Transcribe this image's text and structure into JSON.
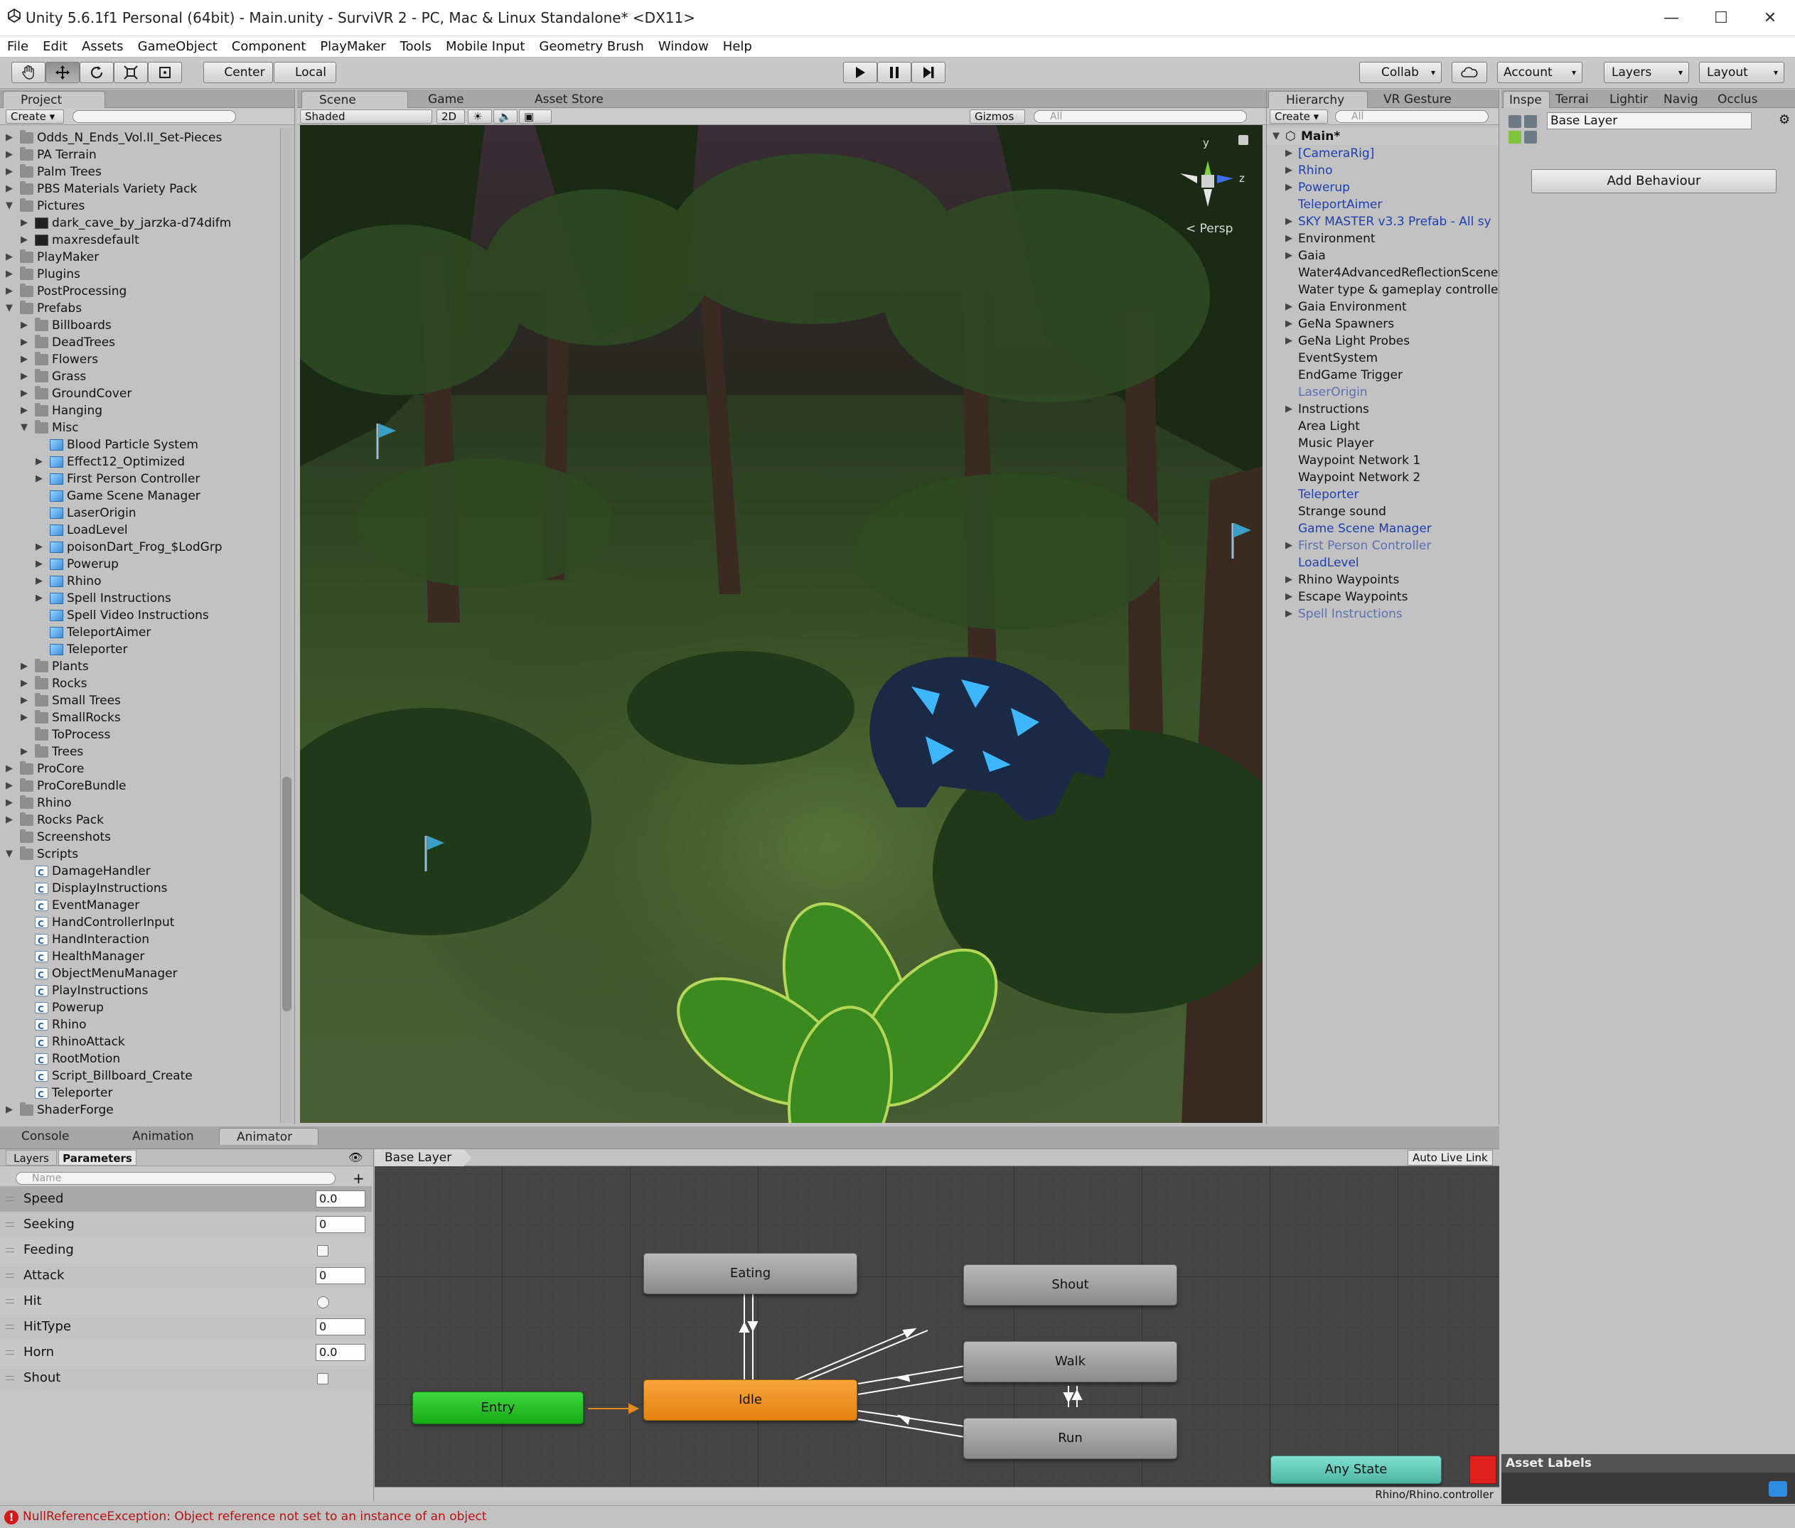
{
  "window": {
    "title": "Unity 5.6.1f1 Personal (64bit) - Main.unity - SurviVR 2 - PC, Mac & Linux Standalone* <DX11>",
    "minimize": "—",
    "maximize": "☐",
    "close": "✕"
  },
  "menu": [
    "File",
    "Edit",
    "Assets",
    "GameObject",
    "Component",
    "PlayMaker",
    "Tools",
    "Mobile Input",
    "Geometry Brush",
    "Window",
    "Help"
  ],
  "toolbar": {
    "pivot": "Center",
    "space": "Local",
    "collab": "Collab",
    "account": "Account",
    "layers": "Layers",
    "layout": "Layout"
  },
  "project": {
    "tab": "Project",
    "create": "Create",
    "items": [
      {
        "label": "Odds_N_Ends_Vol.II_Set-Pieces",
        "depth": 0,
        "icon": "folder",
        "arrow": "▶"
      },
      {
        "label": "PA Terrain",
        "depth": 0,
        "icon": "folder",
        "arrow": "▶"
      },
      {
        "label": "Palm Trees",
        "depth": 0,
        "icon": "folder",
        "arrow": "▶"
      },
      {
        "label": "PBS Materials Variety Pack",
        "depth": 0,
        "icon": "folder",
        "arrow": "▶"
      },
      {
        "label": "Pictures",
        "depth": 0,
        "icon": "folder",
        "arrow": "▼"
      },
      {
        "label": "dark_cave_by_jarzka-d74difm",
        "depth": 1,
        "icon": "image",
        "arrow": "▶"
      },
      {
        "label": "maxresdefault",
        "depth": 1,
        "icon": "image",
        "arrow": "▶"
      },
      {
        "label": "PlayMaker",
        "depth": 0,
        "icon": "folder",
        "arrow": "▶"
      },
      {
        "label": "Plugins",
        "depth": 0,
        "icon": "folder",
        "arrow": "▶"
      },
      {
        "label": "PostProcessing",
        "depth": 0,
        "icon": "folder",
        "arrow": "▶"
      },
      {
        "label": "Prefabs",
        "depth": 0,
        "icon": "folder",
        "arrow": "▼"
      },
      {
        "label": "Billboards",
        "depth": 1,
        "icon": "folder",
        "arrow": "▶"
      },
      {
        "label": "DeadTrees",
        "depth": 1,
        "icon": "folder",
        "arrow": "▶"
      },
      {
        "label": "Flowers",
        "depth": 1,
        "icon": "folder",
        "arrow": "▶"
      },
      {
        "label": "Grass",
        "depth": 1,
        "icon": "folder",
        "arrow": "▶"
      },
      {
        "label": "GroundCover",
        "depth": 1,
        "icon": "folder",
        "arrow": "▶"
      },
      {
        "label": "Hanging",
        "depth": 1,
        "icon": "folder",
        "arrow": "▶"
      },
      {
        "label": "Misc",
        "depth": 1,
        "icon": "folder",
        "arrow": "▼"
      },
      {
        "label": "Blood Particle System",
        "depth": 2,
        "icon": "prefab",
        "arrow": ""
      },
      {
        "label": "Effect12_Optimized",
        "depth": 2,
        "icon": "prefab",
        "arrow": "▶"
      },
      {
        "label": "First Person Controller",
        "depth": 2,
        "icon": "prefab",
        "arrow": "▶"
      },
      {
        "label": "Game Scene Manager",
        "depth": 2,
        "icon": "prefab",
        "arrow": ""
      },
      {
        "label": "LaserOrigin",
        "depth": 2,
        "icon": "prefab",
        "arrow": ""
      },
      {
        "label": "LoadLevel",
        "depth": 2,
        "icon": "prefab",
        "arrow": ""
      },
      {
        "label": "poisonDart_Frog_$LodGrp",
        "depth": 2,
        "icon": "prefab",
        "arrow": "▶"
      },
      {
        "label": "Powerup",
        "depth": 2,
        "icon": "prefab",
        "arrow": "▶"
      },
      {
        "label": "Rhino",
        "depth": 2,
        "icon": "prefab",
        "arrow": "▶"
      },
      {
        "label": "Spell Instructions",
        "depth": 2,
        "icon": "prefab",
        "arrow": "▶"
      },
      {
        "label": "Spell Video Instructions",
        "depth": 2,
        "icon": "prefab",
        "arrow": ""
      },
      {
        "label": "TeleportAimer",
        "depth": 2,
        "icon": "prefab",
        "arrow": ""
      },
      {
        "label": "Teleporter",
        "depth": 2,
        "icon": "prefab",
        "arrow": ""
      },
      {
        "label": "Plants",
        "depth": 1,
        "icon": "folder",
        "arrow": "▶"
      },
      {
        "label": "Rocks",
        "depth": 1,
        "icon": "folder",
        "arrow": "▶"
      },
      {
        "label": "Small Trees",
        "depth": 1,
        "icon": "folder",
        "arrow": "▶"
      },
      {
        "label": "SmallRocks",
        "depth": 1,
        "icon": "folder",
        "arrow": "▶"
      },
      {
        "label": "ToProcess",
        "depth": 1,
        "icon": "folder",
        "arrow": ""
      },
      {
        "label": "Trees",
        "depth": 1,
        "icon": "folder",
        "arrow": "▶"
      },
      {
        "label": "ProCore",
        "depth": 0,
        "icon": "folder",
        "arrow": "▶"
      },
      {
        "label": "ProCoreBundle",
        "depth": 0,
        "icon": "folder",
        "arrow": "▶"
      },
      {
        "label": "Rhino",
        "depth": 0,
        "icon": "folder",
        "arrow": "▶"
      },
      {
        "label": "Rocks Pack",
        "depth": 0,
        "icon": "folder",
        "arrow": "▶"
      },
      {
        "label": "Screenshots",
        "depth": 0,
        "icon": "folder",
        "arrow": ""
      },
      {
        "label": "Scripts",
        "depth": 0,
        "icon": "folder",
        "arrow": "▼"
      },
      {
        "label": "DamageHandler",
        "depth": 1,
        "icon": "script",
        "arrow": ""
      },
      {
        "label": "DisplayInstructions",
        "depth": 1,
        "icon": "script",
        "arrow": ""
      },
      {
        "label": "EventManager",
        "depth": 1,
        "icon": "script",
        "arrow": ""
      },
      {
        "label": "HandControllerInput",
        "depth": 1,
        "icon": "script",
        "arrow": ""
      },
      {
        "label": "HandInteraction",
        "depth": 1,
        "icon": "script",
        "arrow": ""
      },
      {
        "label": "HealthManager",
        "depth": 1,
        "icon": "script",
        "arrow": ""
      },
      {
        "label": "ObjectMenuManager",
        "depth": 1,
        "icon": "script",
        "arrow": ""
      },
      {
        "label": "PlayInstructions",
        "depth": 1,
        "icon": "script",
        "arrow": ""
      },
      {
        "label": "Powerup",
        "depth": 1,
        "icon": "script",
        "arrow": ""
      },
      {
        "label": "Rhino",
        "depth": 1,
        "icon": "script",
        "arrow": ""
      },
      {
        "label": "RhinoAttack",
        "depth": 1,
        "icon": "script",
        "arrow": ""
      },
      {
        "label": "RootMotion",
        "depth": 1,
        "icon": "script",
        "arrow": ""
      },
      {
        "label": "Script_Billboard_Create",
        "depth": 1,
        "icon": "script",
        "arrow": ""
      },
      {
        "label": "Teleporter",
        "depth": 1,
        "icon": "script",
        "arrow": ""
      },
      {
        "label": "ShaderForge",
        "depth": 0,
        "icon": "folder",
        "arrow": "▶"
      }
    ]
  },
  "scene": {
    "tabs": [
      "Scene",
      "Game",
      "Asset Store"
    ],
    "shading": "Shaded",
    "mode2d": "2D",
    "gizmos": "Gizmos",
    "search_placeholder": "All",
    "persp": "Persp",
    "axis_y": "y",
    "axis_z": "z"
  },
  "hierarchy": {
    "tabs": [
      "Hierarchy",
      "VR Gesture"
    ],
    "create": "Create",
    "search_placeholder": "All",
    "scene_name": "Main*",
    "items": [
      {
        "label": "[CameraRig]",
        "arrow": "▶",
        "style": "blue"
      },
      {
        "label": "Rhino",
        "arrow": "▶",
        "style": "blue"
      },
      {
        "label": "Powerup",
        "arrow": "▶",
        "style": "blue"
      },
      {
        "label": "TeleportAimer",
        "arrow": "",
        "style": "blue"
      },
      {
        "label": "SKY MASTER v3.3 Prefab - All sy",
        "arrow": "▶",
        "style": "blue"
      },
      {
        "label": "Environment",
        "arrow": "▶",
        "style": ""
      },
      {
        "label": "Gaia",
        "arrow": "▶",
        "style": ""
      },
      {
        "label": "Water4AdvancedReflectionScene",
        "arrow": "",
        "style": ""
      },
      {
        "label": "Water type & gameplay controlle",
        "arrow": "",
        "style": ""
      },
      {
        "label": "Gaia Environment",
        "arrow": "▶",
        "style": ""
      },
      {
        "label": "GeNa Spawners",
        "arrow": "▶",
        "style": ""
      },
      {
        "label": "GeNa Light Probes",
        "arrow": "▶",
        "style": ""
      },
      {
        "label": "EventSystem",
        "arrow": "",
        "style": ""
      },
      {
        "label": "EndGame Trigger",
        "arrow": "",
        "style": ""
      },
      {
        "label": "LaserOrigin",
        "arrow": "",
        "style": "ltblue"
      },
      {
        "label": "Instructions",
        "arrow": "▶",
        "style": ""
      },
      {
        "label": "Area Light",
        "arrow": "",
        "style": ""
      },
      {
        "label": "Music Player",
        "arrow": "",
        "style": ""
      },
      {
        "label": "Waypoint Network 1",
        "arrow": "",
        "style": ""
      },
      {
        "label": "Waypoint Network 2",
        "arrow": "",
        "style": ""
      },
      {
        "label": "Teleporter",
        "arrow": "",
        "style": "blue"
      },
      {
        "label": "Strange sound",
        "arrow": "",
        "style": ""
      },
      {
        "label": "Game Scene Manager",
        "arrow": "",
        "style": "blue"
      },
      {
        "label": "First Person Controller",
        "arrow": "▶",
        "style": "ltblue"
      },
      {
        "label": "LoadLevel",
        "arrow": "",
        "style": "blue"
      },
      {
        "label": "Rhino Waypoints",
        "arrow": "▶",
        "style": ""
      },
      {
        "label": "Escape Waypoints",
        "arrow": "▶",
        "style": ""
      },
      {
        "label": "Spell Instructions",
        "arrow": "▶",
        "style": "ltblue"
      }
    ]
  },
  "inspector": {
    "tabs": [
      "Inspe",
      "Terrai",
      "Lightir",
      "Navig",
      "Occlus"
    ],
    "layer_name": "Base Layer",
    "add_behaviour": "Add Behaviour",
    "asset_labels": "Asset Labels"
  },
  "bottom": {
    "tabs": [
      "Console",
      "Animation",
      "Animator"
    ],
    "subtabs": [
      "Layers",
      "Parameters"
    ],
    "search_placeholder": "Name",
    "parameters": [
      {
        "name": "Speed",
        "type": "float",
        "value": "0.0"
      },
      {
        "name": "Seeking",
        "type": "int",
        "value": "0"
      },
      {
        "name": "Feeding",
        "type": "bool",
        "value": ""
      },
      {
        "name": "Attack",
        "type": "int",
        "value": "0"
      },
      {
        "name": "Hit",
        "type": "trigger",
        "value": ""
      },
      {
        "name": "HitType",
        "type": "int",
        "value": "0"
      },
      {
        "name": "Horn",
        "type": "float",
        "value": "0.0"
      },
      {
        "name": "Shout",
        "type": "bool",
        "value": ""
      }
    ],
    "graph": {
      "breadcrumb": "Base Layer",
      "auto_live_link": "Auto Live Link",
      "footer_path": "Rhino/Rhino.controller",
      "states": {
        "eating": "Eating",
        "shout": "Shout",
        "walk": "Walk",
        "idle": "Idle",
        "entry": "Entry",
        "run": "Run",
        "any": "Any State"
      }
    }
  },
  "status": {
    "message": "NullReferenceException: Object reference not set to an instance of an object"
  },
  "colors": {
    "entry": "#1fbf20",
    "idle": "#f28c1a",
    "any_state": "#5fc6b4",
    "error": "#d21a1a"
  }
}
